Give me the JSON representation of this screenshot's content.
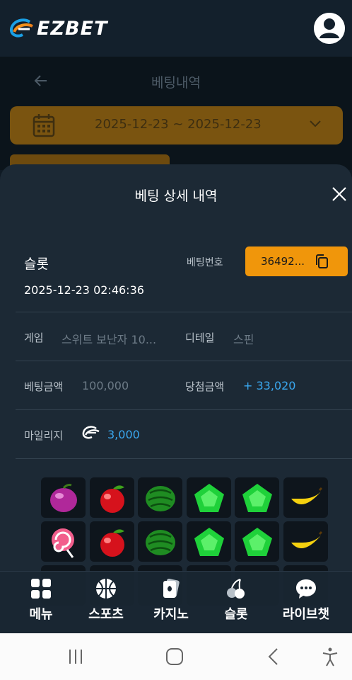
{
  "header": {
    "brand": "EZBET"
  },
  "background_page": {
    "title": "베팅내역",
    "date_range": "2025-12-23  ~  2025-12-23"
  },
  "modal": {
    "title": "베팅 상세 내역",
    "category": "슬롯",
    "datetime": "2025-12-23 02:46:36",
    "bet_number_label": "베팅번호",
    "bet_number": "36492...",
    "game_label": "게임",
    "game_value": "스위트 보난자 10...",
    "detail_label": "디테일",
    "detail_value": "스핀",
    "bet_amount_label": "베팅금액",
    "bet_amount_value": "100,000",
    "win_amount_label": "당첨금액",
    "win_amount_value": "+ 33,020",
    "mileage_label": "마일리지",
    "mileage_value": "3,000"
  },
  "slot_grid": {
    "rows": [
      [
        "plum",
        "apple",
        "watermelon",
        "green-gem",
        "green-gem",
        "banana"
      ],
      [
        "lollipop",
        "apple",
        "watermelon",
        "green-gem",
        "green-gem",
        "banana"
      ]
    ]
  },
  "bottom_nav": [
    {
      "label": "메뉴",
      "icon": "menu-grid-icon"
    },
    {
      "label": "스포츠",
      "icon": "basketball-icon"
    },
    {
      "label": "카지노",
      "icon": "casino-card-icon"
    },
    {
      "label": "슬롯",
      "icon": "cherry-icon"
    },
    {
      "label": "라이브챗",
      "icon": "chat-bubble-icon"
    }
  ],
  "colors": {
    "accent": "#f0960b",
    "win_blue": "#3aa8f0",
    "modal_bg": "#1c2935"
  }
}
